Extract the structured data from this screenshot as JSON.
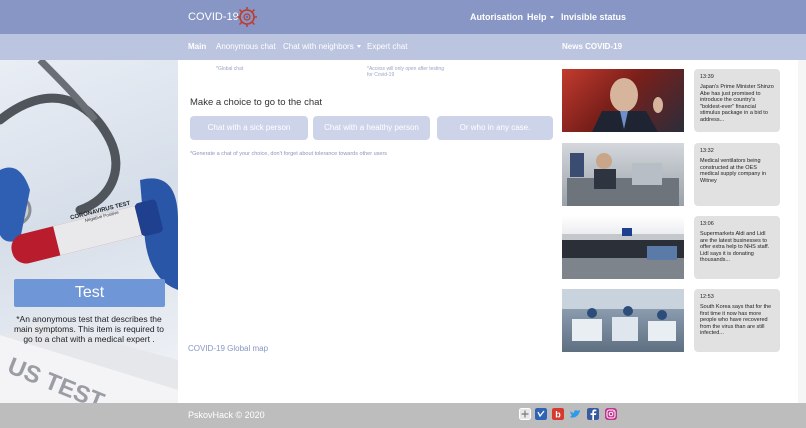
{
  "header": {
    "brand": "COVID-19",
    "nav": {
      "auth": "Autorisation",
      "help": "Help",
      "status": "Invisible status"
    }
  },
  "subnav": {
    "main": "Main",
    "anonymous": "Anonymous chat",
    "neighbors": "Chat with neighbors",
    "expert": "Expert chat",
    "news": "News COVID-19",
    "hint_global": "*Global chat",
    "hint_access": "*Access will only open after testing for Covid-19"
  },
  "left_panel": {
    "tube_label_line1": "CORONAVIRUS TEST",
    "tube_label_line2": "Negative   Positive",
    "paper_text": "US TEST",
    "test_button": "Test",
    "description": "*An anonymous test that describes the main symptoms. This item is required to go to a chat with a medical expert ."
  },
  "chat": {
    "title": "Make a choice to go to the chat",
    "buttons": [
      "Chat with a sick person",
      "Chat with a healthy person",
      "Or who in any case."
    ],
    "hint": "*Generate a chat of your choice, don't forget about tolerance towards other users",
    "global_map": "COVID-19 Global map"
  },
  "news": [
    {
      "time": "13:39",
      "text": "Japan's Prime Minister Shinzo Abe has just promised to introduce the country's \"boldest-ever\" financial stimulus package in a bid to address..."
    },
    {
      "time": "13:32",
      "text": "Medical ventilators being constructed at the OES medical supply company in Witney"
    },
    {
      "time": "13:06",
      "text": "Supermarkets Aldi and Lidl are the latest businesses to offer extra help to NHS staff. Lidl says it is donating thousands..."
    },
    {
      "time": "12:53",
      "text": "South Korea says that for the first time it now has more people who have recovered from the virus than are still infected..."
    }
  ],
  "footer": {
    "copyright": "PskovHack ©  2020",
    "social": [
      "plus-icon",
      "vk-icon",
      "b-icon",
      "twitter-icon",
      "facebook-icon",
      "instagram-icon"
    ]
  },
  "colors": {
    "header": "#8796c4",
    "subnav": "#bcc5df",
    "button_primary": "#6f96d6",
    "button_choice": "#cdd4ea",
    "footer": "#bdbdbd"
  }
}
